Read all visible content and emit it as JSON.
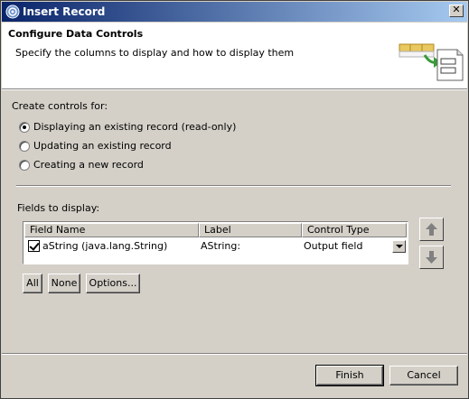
{
  "window": {
    "title": "Insert Record",
    "app_icon": "eclipse-icon",
    "close_icon": "close-icon"
  },
  "banner": {
    "title": "Configure Data Controls",
    "subtitle": "Specify the columns to display and how to display them",
    "image": "data-controls-wizard-icon"
  },
  "create_controls": {
    "label": "Create controls for:",
    "options": [
      {
        "label": "Displaying an existing record (read-only)",
        "selected": true
      },
      {
        "label": "Updating an existing record",
        "selected": false
      },
      {
        "label": "Creating a new record",
        "selected": false
      }
    ]
  },
  "fields": {
    "label": "Fields to display:",
    "columns": [
      "Field Name",
      "Label",
      "Control Type"
    ],
    "rows": [
      {
        "checked": true,
        "field_name": "aString (java.lang.String)",
        "label": "AString:",
        "control_type": "Output field"
      }
    ],
    "move_up_icon": "arrow-up-icon",
    "move_down_icon": "arrow-down-icon"
  },
  "buttons": {
    "all": "All",
    "none": "None",
    "options": "Options...",
    "finish": "Finish",
    "cancel": "Cancel"
  },
  "colors": {
    "titlebar_start": "#0a246a",
    "titlebar_end": "#a6caf0",
    "dialog_bg": "#d4d0c8"
  }
}
